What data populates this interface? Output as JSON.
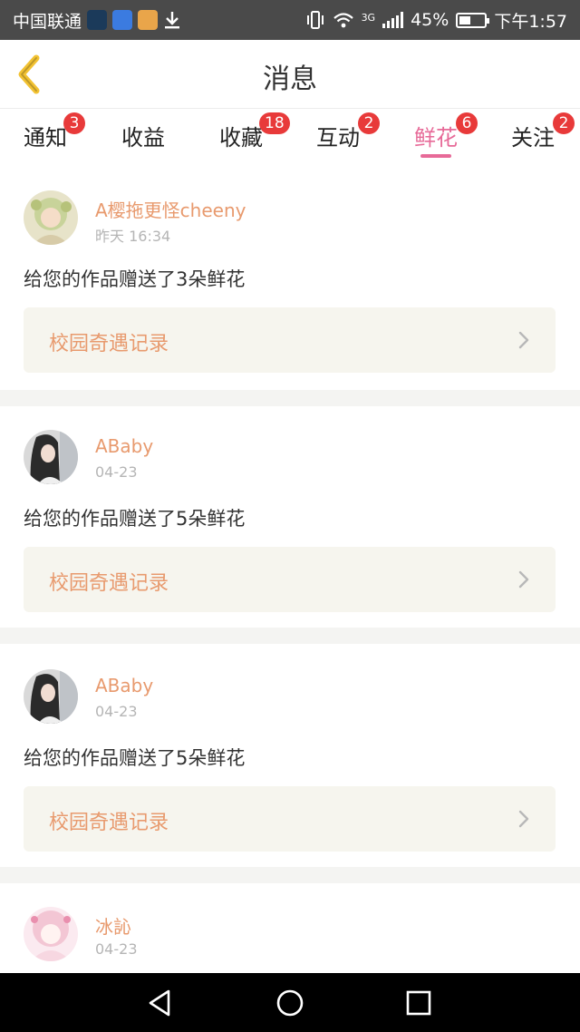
{
  "status_bar": {
    "carrier": "中国联通",
    "network": "3G",
    "battery": "45%",
    "time": "下午1:57",
    "icons": [
      "signal-app-icon",
      "baidu-paw-icon",
      "game-app-icon",
      "download-icon",
      "vibrate-icon",
      "wifi-icon",
      "cell-signal-icon",
      "battery-icon"
    ]
  },
  "header": {
    "title": "消息",
    "back_icon": "chevron-left-icon"
  },
  "tabs": [
    {
      "label": "通知",
      "badge": "3"
    },
    {
      "label": "收益",
      "badge": ""
    },
    {
      "label": "收藏",
      "badge": "18"
    },
    {
      "label": "互动",
      "badge": "2"
    },
    {
      "label": "鲜花",
      "badge": "6",
      "active": true
    },
    {
      "label": "关注",
      "badge": "2"
    }
  ],
  "messages": [
    {
      "user": "A樱拖更怪cheeny",
      "time": "昨天 16:34",
      "text": "给您的作品赠送了3朵鲜花",
      "link": "校园奇遇记录"
    },
    {
      "user": "ABaby",
      "time": "04-23",
      "text": "给您的作品赠送了5朵鲜花",
      "link": "校园奇遇记录"
    },
    {
      "user": "ABaby",
      "time": "04-23",
      "text": "给您的作品赠送了5朵鲜花",
      "link": "校园奇遇记录"
    },
    {
      "user": "冰訫",
      "time": "04-23"
    }
  ],
  "colors": {
    "accent_pink": "#e76a98",
    "name_orange": "#e89a6e",
    "badge_red": "#e83a3a",
    "back_yellow": "#f2c232",
    "link_bg": "#f6f5ee"
  },
  "nav": {
    "back": "back-triangle-icon",
    "home": "home-circle-icon",
    "recents": "recents-square-icon"
  }
}
